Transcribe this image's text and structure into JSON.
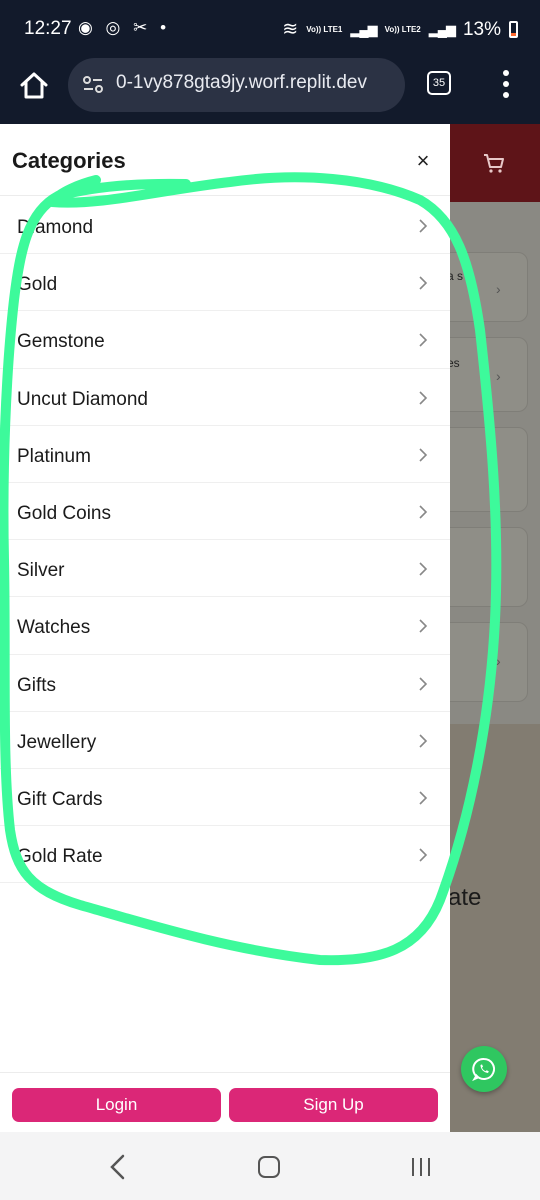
{
  "status_bar": {
    "time": "12:27",
    "battery": "13%",
    "sim1_label": "Vo)) LTE1",
    "sim2_label": "Vo)) LTE2"
  },
  "browser": {
    "url": "0-1vy878gta9jy.worf.replit.dev",
    "tab_count": "35"
  },
  "drawer": {
    "title": "Categories",
    "close_label": "×",
    "categories": [
      {
        "label": "Diamond"
      },
      {
        "label": "Gold"
      },
      {
        "label": "Gemstone"
      },
      {
        "label": "Uncut Diamond"
      },
      {
        "label": "Platinum"
      },
      {
        "label": "Gold Coins"
      },
      {
        "label": "Silver"
      },
      {
        "label": "Watches"
      },
      {
        "label": "Gifts"
      },
      {
        "label": "Jewellery"
      },
      {
        "label": "Gift Cards"
      },
      {
        "label": "Gold Rate"
      }
    ],
    "login_label": "Login",
    "signup_label": "Sign Up"
  },
  "background_page": {
    "card1_text": "a s",
    "card2_text": "es",
    "rate_text": "ate"
  },
  "colors": {
    "accent_pink": "#db2777",
    "header_red": "#5e1418",
    "whatsapp_green": "#2fc760",
    "annotation_green": "#3dfa9b"
  },
  "icons": [
    "home-icon",
    "site-info-icon",
    "tabs-icon",
    "more-menu-icon",
    "cart-icon",
    "close-icon",
    "chevron-right-icon",
    "whatsapp-icon",
    "nav-back-icon",
    "nav-home-icon",
    "nav-recents-icon"
  ]
}
